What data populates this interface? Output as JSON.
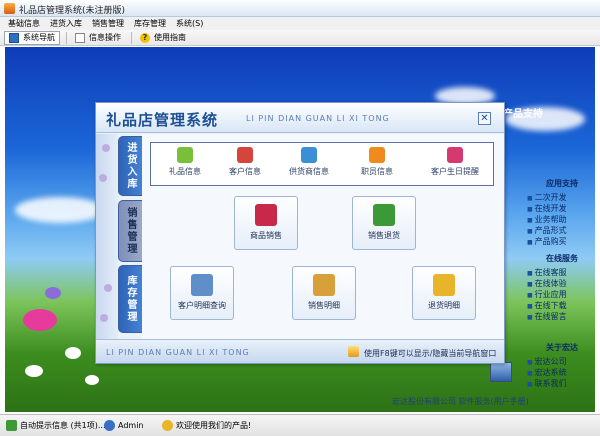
{
  "window": {
    "title": "礼品店管理系统(未注册版)"
  },
  "menu": [
    "基础信息",
    "进货入库",
    "销售管理",
    "库存管理",
    "系统(S)"
  ],
  "toolbar": [
    {
      "label": "系统导航",
      "icon": "nav-icon",
      "active": true
    },
    {
      "label": "信息操作",
      "icon": "document-icon",
      "active": false
    },
    {
      "label": "使用指南",
      "icon": "help-icon",
      "active": false
    }
  ],
  "nav": {
    "title": "礼品店管理系统",
    "subtitle": "LI PIN DIAN GUAN LI XI TONG",
    "close_glyph": "✕",
    "tabs": [
      {
        "label": "进货入库",
        "active": true
      },
      {
        "label": "销售管理",
        "active": false
      },
      {
        "label": "库存管理",
        "active": true
      }
    ],
    "top_items": [
      {
        "label": "礼品信息",
        "icon": "gift-icon",
        "color": "#7abf3a"
      },
      {
        "label": "客户信息",
        "icon": "customer-icon",
        "color": "#d6453c"
      },
      {
        "label": "供货商信息",
        "icon": "supplier-icon",
        "color": "#3a8fd6"
      },
      {
        "label": "职员信息",
        "icon": "staff-icon",
        "color": "#f08a1c"
      },
      {
        "label": "客户生日提醒",
        "icon": "cake-icon",
        "color": "#d43a6f"
      }
    ],
    "cards": [
      {
        "label": "商品销售",
        "icon": "sale-icon",
        "color": "#c8284a"
      },
      {
        "label": "销售退货",
        "icon": "return-icon",
        "color": "#3c9a36"
      },
      {
        "label": "客户明细查询",
        "icon": "query-icon",
        "color": "#5f8fc8"
      },
      {
        "label": "销售明细",
        "icon": "register-icon",
        "color": "#d8a03a"
      },
      {
        "label": "退货明细",
        "icon": "return-detail-icon",
        "color": "#e8b42a"
      }
    ],
    "footer_pinyin": "LI PIN DIAN GUAN LI XI TONG",
    "footer_hint": "使用F8键可以显示/隐藏当前导航窗口"
  },
  "side_panel": {
    "title": "产品支持",
    "groups": [
      {
        "title": "应用支持",
        "items": [
          "二次开发",
          "在线开发",
          "业务帮助",
          "产品形式",
          "产品购买"
        ]
      },
      {
        "title": "在线服务",
        "items": [
          "在线客服",
          "在线体验",
          "行业应用",
          "在线下载",
          "在线留言"
        ]
      },
      {
        "title": "关于宏达",
        "items": [
          "宏达公司",
          "宏达系统",
          "联系我们"
        ]
      }
    ]
  },
  "bottom_note": "宏达股份有限公司  软件服务(用户手册)",
  "status": {
    "tips": "自动提示信息 (共1项)...",
    "user": "Admin",
    "welcome": "欢迎使用我们的产品!"
  }
}
